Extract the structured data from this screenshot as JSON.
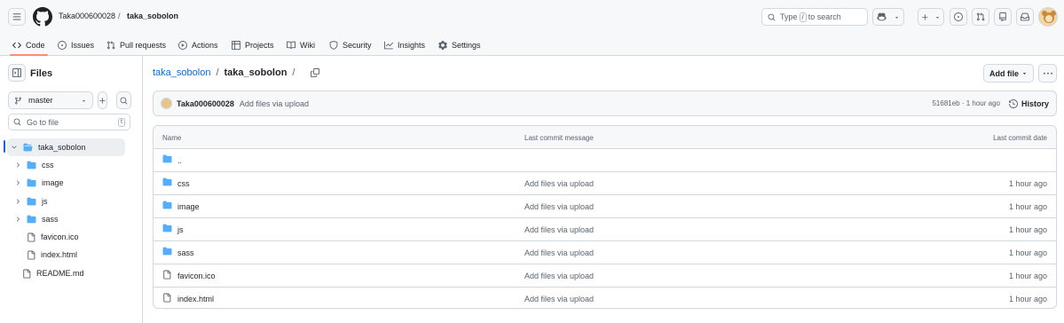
{
  "header": {
    "owner": "Taka000600028",
    "separator": "/",
    "repo": "taka_sobolon",
    "search_prefix": "Type",
    "search_key": "/",
    "search_suffix": "to search"
  },
  "tabs": [
    {
      "label": "Code",
      "icon": "code-icon"
    },
    {
      "label": "Issues",
      "icon": "issue-icon"
    },
    {
      "label": "Pull requests",
      "icon": "pull-request-icon"
    },
    {
      "label": "Actions",
      "icon": "play-icon"
    },
    {
      "label": "Projects",
      "icon": "table-icon"
    },
    {
      "label": "Wiki",
      "icon": "book-icon"
    },
    {
      "label": "Security",
      "icon": "shield-icon"
    },
    {
      "label": "Insights",
      "icon": "graph-icon"
    },
    {
      "label": "Settings",
      "icon": "gear-icon"
    }
  ],
  "sidebar": {
    "title": "Files",
    "branch": "master",
    "goto_placeholder": "Go to file",
    "goto_key": "t",
    "tree": [
      {
        "label": "taka_sobolon",
        "type": "folder-open",
        "selected": true
      },
      {
        "label": "css",
        "type": "folder"
      },
      {
        "label": "image",
        "type": "folder"
      },
      {
        "label": "js",
        "type": "folder"
      },
      {
        "label": "sass",
        "type": "folder"
      },
      {
        "label": "favicon.ico",
        "type": "file"
      },
      {
        "label": "index.html",
        "type": "file"
      },
      {
        "label": "README.md",
        "type": "file"
      }
    ]
  },
  "main": {
    "path_root": "taka_sobolon",
    "path_sep": "/",
    "path_current": "taka_sobolon",
    "path_trail": "/",
    "add_file_label": "Add file",
    "commit": {
      "author": "Taka000600028",
      "message": "Add files via upload",
      "meta": "51681eb · 1 hour ago",
      "history_label": "History"
    },
    "table": {
      "headers": {
        "name": "Name",
        "message": "Last commit message",
        "date": "Last commit date"
      },
      "rows": [
        {
          "name": "..",
          "type": "folder",
          "message": "",
          "date": ""
        },
        {
          "name": "css",
          "type": "folder",
          "message": "Add files via upload",
          "date": "1 hour ago"
        },
        {
          "name": "image",
          "type": "folder",
          "message": "Add files via upload",
          "date": "1 hour ago"
        },
        {
          "name": "js",
          "type": "folder",
          "message": "Add files via upload",
          "date": "1 hour ago"
        },
        {
          "name": "sass",
          "type": "folder",
          "message": "Add files via upload",
          "date": "1 hour ago"
        },
        {
          "name": "favicon.ico",
          "type": "file",
          "message": "Add files via upload",
          "date": "1 hour ago"
        },
        {
          "name": "index.html",
          "type": "file",
          "message": "Add files via upload",
          "date": "1 hour ago"
        }
      ]
    }
  },
  "colors": {
    "accent_underline": "#fd8c73",
    "link": "#0969da",
    "folder": "#54aeff"
  }
}
